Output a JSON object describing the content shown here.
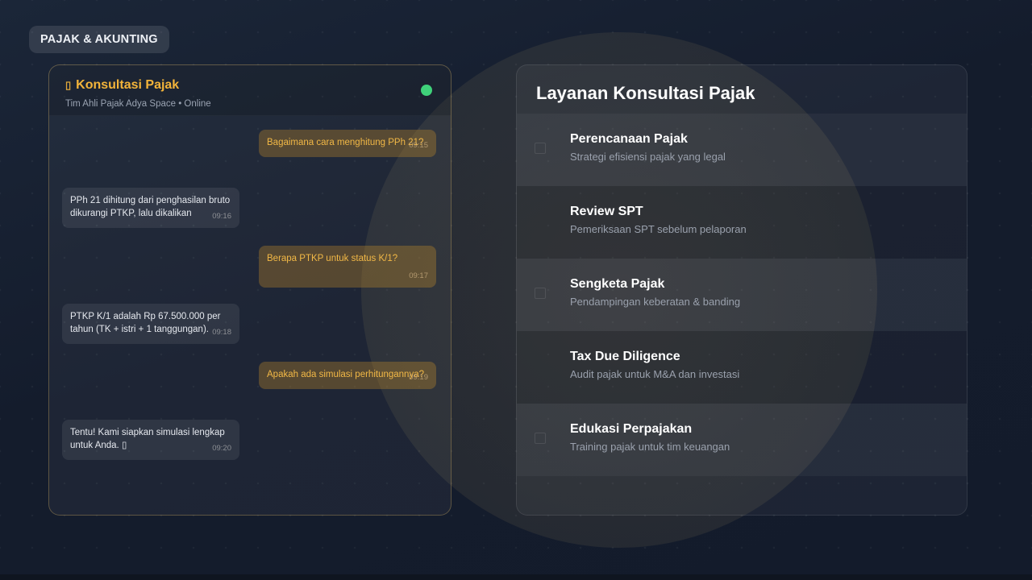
{
  "brand": {
    "label": "PAJAK & AKUNTING"
  },
  "chat": {
    "title": "Konsultasi Pajak",
    "subtitle": "Tim Ahli Pajak Adya Space • Online",
    "status_color": "#3fd17a",
    "icon": "chat-icon",
    "messages": [
      {
        "from": "user",
        "text": "Bagaimana cara menghitung PPh 21?",
        "time": "09:15"
      },
      {
        "from": "agent",
        "text": "PPh 21 dihitung dari penghasilan bruto dikurangi PTKP, lalu dikalikan",
        "time": "09:16"
      },
      {
        "from": "user",
        "text": "Berapa PTKP untuk status K/1?",
        "time": "09:17"
      },
      {
        "from": "agent",
        "text": "PTKP K/1 adalah Rp 67.500.000 per tahun (TK + istri + 1 tanggungan).",
        "time": "09:18"
      },
      {
        "from": "user",
        "text": "Apakah ada simulasi perhitungannya?",
        "time": "09:19"
      },
      {
        "from": "agent",
        "text": "Tentu! Kami siapkan simulasi lengkap untuk Anda. ▯",
        "time": "09:20"
      }
    ]
  },
  "services": {
    "title": "Layanan Konsultasi Pajak",
    "items": [
      {
        "name": "Perencanaan Pajak",
        "desc": "Strategi efisiensi pajak yang legal",
        "icon": "planning-icon"
      },
      {
        "name": "Review SPT",
        "desc": "Pemeriksaan SPT sebelum pelaporan",
        "icon": "review-icon"
      },
      {
        "name": "Sengketa Pajak",
        "desc": "Pendampingan keberatan & banding",
        "icon": "dispute-icon"
      },
      {
        "name": "Tax Due Diligence",
        "desc": "Audit pajak untuk M&A dan investasi",
        "icon": "audit-icon"
      },
      {
        "name": "Edukasi Perpajakan",
        "desc": "Training pajak untuk tim keuangan",
        "icon": "education-icon"
      }
    ]
  },
  "colors": {
    "accent": "#f3b43a",
    "user_bubble_text": "#f2b846"
  }
}
